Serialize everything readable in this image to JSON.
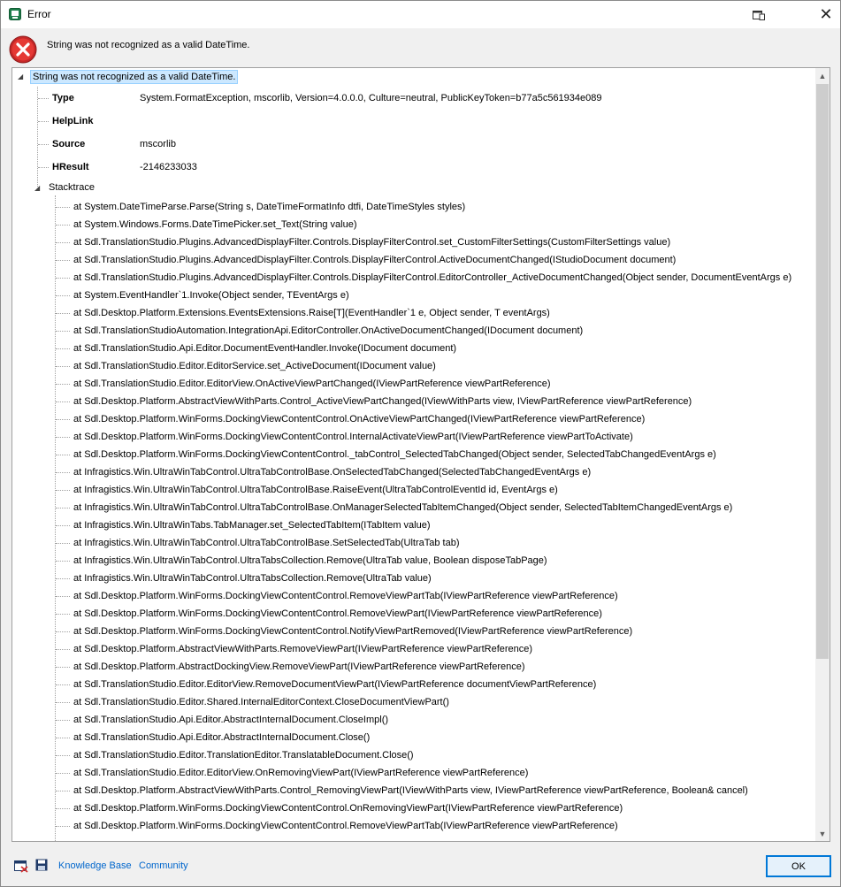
{
  "window": {
    "title": "Error"
  },
  "header": {
    "message": "String was not recognized as a valid DateTime."
  },
  "tree": {
    "root_label": "String was not recognized as a valid DateTime.",
    "properties": [
      {
        "name": "Type",
        "value": "System.FormatException, mscorlib, Version=4.0.0.0, Culture=neutral, PublicKeyToken=b77a5c561934e089"
      },
      {
        "name": "HelpLink",
        "value": ""
      },
      {
        "name": "Source",
        "value": "mscorlib"
      },
      {
        "name": "HResult",
        "value": "-2146233033"
      }
    ],
    "stacktrace_label": "Stacktrace",
    "frames": [
      "at System.DateTimeParse.Parse(String s, DateTimeFormatInfo dtfi, DateTimeStyles styles)",
      "at System.Windows.Forms.DateTimePicker.set_Text(String value)",
      "at Sdl.TranslationStudio.Plugins.AdvancedDisplayFilter.Controls.DisplayFilterControl.set_CustomFilterSettings(CustomFilterSettings value)",
      "at Sdl.TranslationStudio.Plugins.AdvancedDisplayFilter.Controls.DisplayFilterControl.ActiveDocumentChanged(IStudioDocument document)",
      "at Sdl.TranslationStudio.Plugins.AdvancedDisplayFilter.Controls.DisplayFilterControl.EditorController_ActiveDocumentChanged(Object sender, DocumentEventArgs e)",
      "at System.EventHandler`1.Invoke(Object sender, TEventArgs e)",
      "at Sdl.Desktop.Platform.Extensions.EventsExtensions.Raise[T](EventHandler`1 e, Object sender, T eventArgs)",
      "at Sdl.TranslationStudioAutomation.IntegrationApi.EditorController.OnActiveDocumentChanged(IDocument document)",
      "at Sdl.TranslationStudio.Api.Editor.DocumentEventHandler.Invoke(IDocument document)",
      "at Sdl.TranslationStudio.Editor.EditorService.set_ActiveDocument(IDocument value)",
      "at Sdl.TranslationStudio.Editor.EditorView.OnActiveViewPartChanged(IViewPartReference viewPartReference)",
      "at Sdl.Desktop.Platform.AbstractViewWithParts.Control_ActiveViewPartChanged(IViewWithParts view, IViewPartReference viewPartReference)",
      "at Sdl.Desktop.Platform.WinForms.DockingViewContentControl.OnActiveViewPartChanged(IViewPartReference viewPartReference)",
      "at Sdl.Desktop.Platform.WinForms.DockingViewContentControl.InternalActivateViewPart(IViewPartReference viewPartToActivate)",
      "at Sdl.Desktop.Platform.WinForms.DockingViewContentControl._tabControl_SelectedTabChanged(Object sender, SelectedTabChangedEventArgs e)",
      "at Infragistics.Win.UltraWinTabControl.UltraTabControlBase.OnSelectedTabChanged(SelectedTabChangedEventArgs e)",
      "at Infragistics.Win.UltraWinTabControl.UltraTabControlBase.RaiseEvent(UltraTabControlEventId id, EventArgs e)",
      "at Infragistics.Win.UltraWinTabControl.UltraTabControlBase.OnManagerSelectedTabItemChanged(Object sender, SelectedTabItemChangedEventArgs e)",
      "at Infragistics.Win.UltraWinTabs.TabManager.set_SelectedTabItem(ITabItem value)",
      "at Infragistics.Win.UltraWinTabControl.UltraTabControlBase.SetSelectedTab(UltraTab tab)",
      "at Infragistics.Win.UltraWinTabControl.UltraTabsCollection.Remove(UltraTab value, Boolean disposeTabPage)",
      "at Infragistics.Win.UltraWinTabControl.UltraTabsCollection.Remove(UltraTab value)",
      "at Sdl.Desktop.Platform.WinForms.DockingViewContentControl.RemoveViewPartTab(IViewPartReference viewPartReference)",
      "at Sdl.Desktop.Platform.WinForms.DockingViewContentControl.RemoveViewPart(IViewPartReference viewPartReference)",
      "at Sdl.Desktop.Platform.WinForms.DockingViewContentControl.NotifyViewPartRemoved(IViewPartReference viewPartReference)",
      "at Sdl.Desktop.Platform.AbstractViewWithParts.RemoveViewPart(IViewPartReference viewPartReference)",
      "at Sdl.Desktop.Platform.AbstractDockingView.RemoveViewPart(IViewPartReference viewPartReference)",
      "at Sdl.TranslationStudio.Editor.EditorView.RemoveDocumentViewPart(IViewPartReference documentViewPartReference)",
      "at Sdl.TranslationStudio.Editor.Shared.InternalEditorContext.CloseDocumentViewPart()",
      "at Sdl.TranslationStudio.Api.Editor.AbstractInternalDocument.CloseImpl()",
      "at Sdl.TranslationStudio.Api.Editor.AbstractInternalDocument.Close()",
      "at Sdl.TranslationStudio.Editor.TranslationEditor.TranslatableDocument.Close()",
      "at Sdl.TranslationStudio.Editor.EditorView.OnRemovingViewPart(IViewPartReference viewPartReference)",
      "at Sdl.Desktop.Platform.AbstractViewWithParts.Control_RemovingViewPart(IViewWithParts view, IViewPartReference viewPartReference, Boolean& cancel)",
      "at Sdl.Desktop.Platform.WinForms.DockingViewContentControl.OnRemovingViewPart(IViewPartReference viewPartReference)",
      "at Sdl.Desktop.Platform.WinForms.DockingViewContentControl.RemoveViewPartTab(IViewPartReference viewPartReference)"
    ]
  },
  "footer": {
    "knowledge_base": "Knowledge Base",
    "community": "Community",
    "ok": "OK"
  },
  "icons": {
    "app": "app-window-icon",
    "pin": "pin-window-icon",
    "close": "close-icon",
    "error": "error-icon",
    "email": "email-report-icon",
    "save": "save-icon"
  },
  "colors": {
    "accent": "#0078d7",
    "link": "#0066cc",
    "error_red": "#d32f2f"
  }
}
